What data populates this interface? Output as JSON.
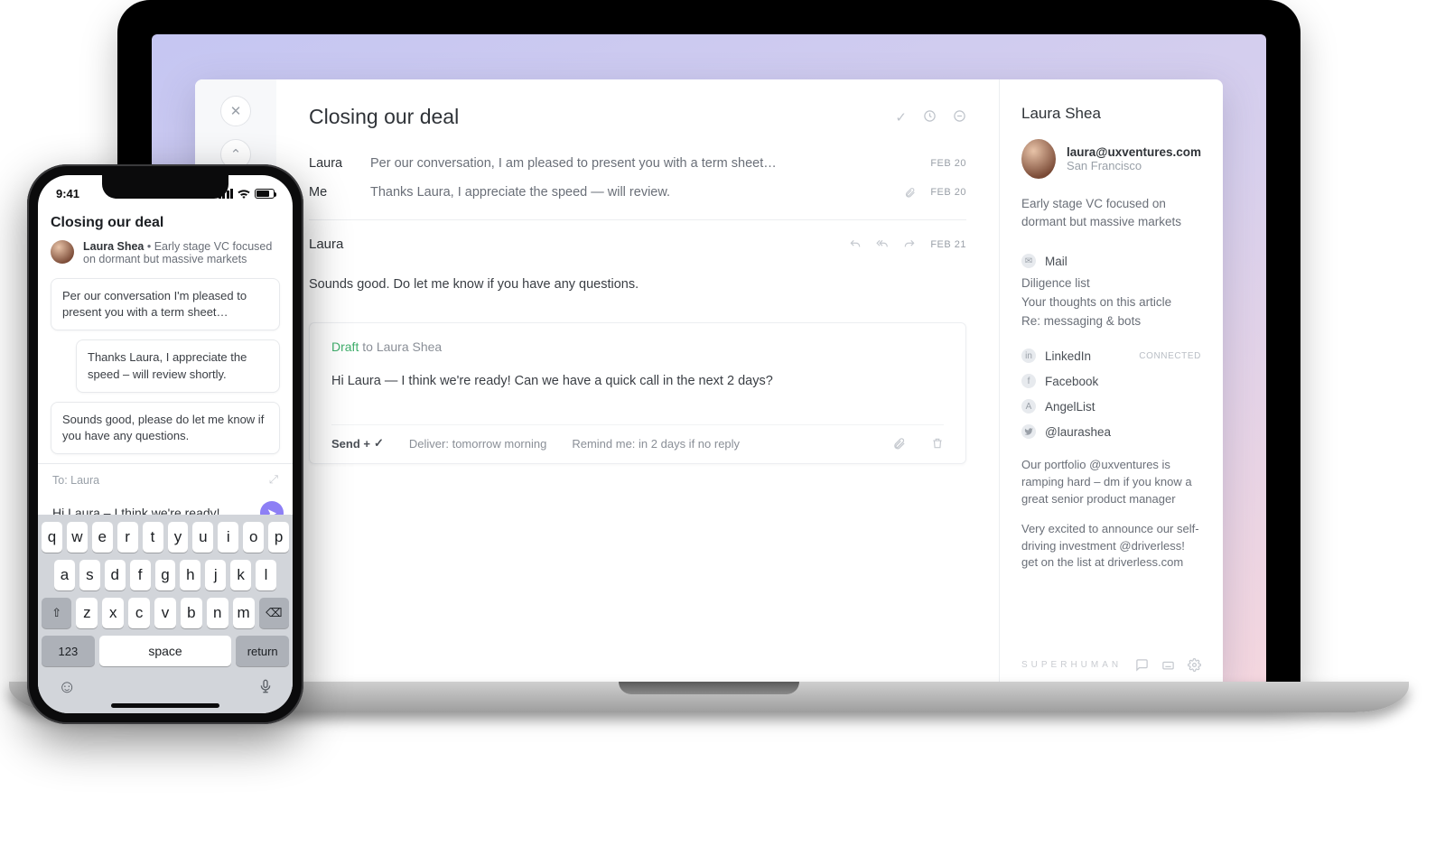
{
  "desktop": {
    "thread_title": "Closing our deal",
    "messages": [
      {
        "who": "Laura",
        "preview": "Per our conversation, I am pleased to present you with a term sheet…",
        "date": "FEB 20",
        "attach": false
      },
      {
        "who": "Me",
        "preview": "Thanks Laura, I appreciate the speed — will review.",
        "date": "FEB 20",
        "attach": true
      }
    ],
    "expanded": {
      "who": "Laura",
      "date": "FEB 21",
      "body": "Sounds good.  Do let me know if you have any questions."
    },
    "draft": {
      "tag": "Draft",
      "to_prefix": " to ",
      "to_name": "Laura Shea",
      "body": "Hi Laura — I think we're ready! Can we have a quick call in the next 2 days?",
      "send_label": "Send +",
      "deliver": "Deliver: tomorrow morning",
      "remind": "Remind me: in 2 days if no reply"
    }
  },
  "contact": {
    "name": "Laura Shea",
    "email": "laura@uxventures.com",
    "location": "San Francisco",
    "bio": "Early stage VC focused on dormant but massive markets",
    "mail_label": "Mail",
    "mail_items": [
      "Diligence list",
      "Your thoughts on this article",
      "Re: messaging & bots"
    ],
    "socials": {
      "linkedin": "LinkedIn",
      "linkedin_status": "CONNECTED",
      "facebook": "Facebook",
      "angellist": "AngelList",
      "twitter": "@laurashea"
    },
    "tweets": [
      "Our portfolio @uxventures is ramping hard – dm if you know a great senior product manager",
      "Very excited to announce our self-driving investment @driverless! get on the list at driverless.com"
    ],
    "brand": "SUPERHUMAN"
  },
  "phone": {
    "time": "9:41",
    "title": "Closing our deal",
    "sender_name": "Laura Shea",
    "sender_sep": "  •  ",
    "sender_tag": "Early stage VC focused on dormant but massive markets",
    "bubbles": [
      {
        "side": "left",
        "text": "Per our conversation I'm pleased to present you with a term sheet…"
      },
      {
        "side": "right",
        "text": "Thanks Laura, I appreciate the speed – will review shortly."
      },
      {
        "side": "left",
        "text": "Sounds good, please do let me know if you have any questions."
      }
    ],
    "to_label": "To: Laura",
    "compose": "Hi Laura – I think we're ready!",
    "keys": {
      "r1": [
        "q",
        "w",
        "e",
        "r",
        "t",
        "y",
        "u",
        "i",
        "o",
        "p"
      ],
      "r2": [
        "a",
        "s",
        "d",
        "f",
        "g",
        "h",
        "j",
        "k",
        "l"
      ],
      "r3": [
        "z",
        "x",
        "c",
        "v",
        "b",
        "n",
        "m"
      ],
      "num": "123",
      "space": "space",
      "ret": "return"
    }
  }
}
